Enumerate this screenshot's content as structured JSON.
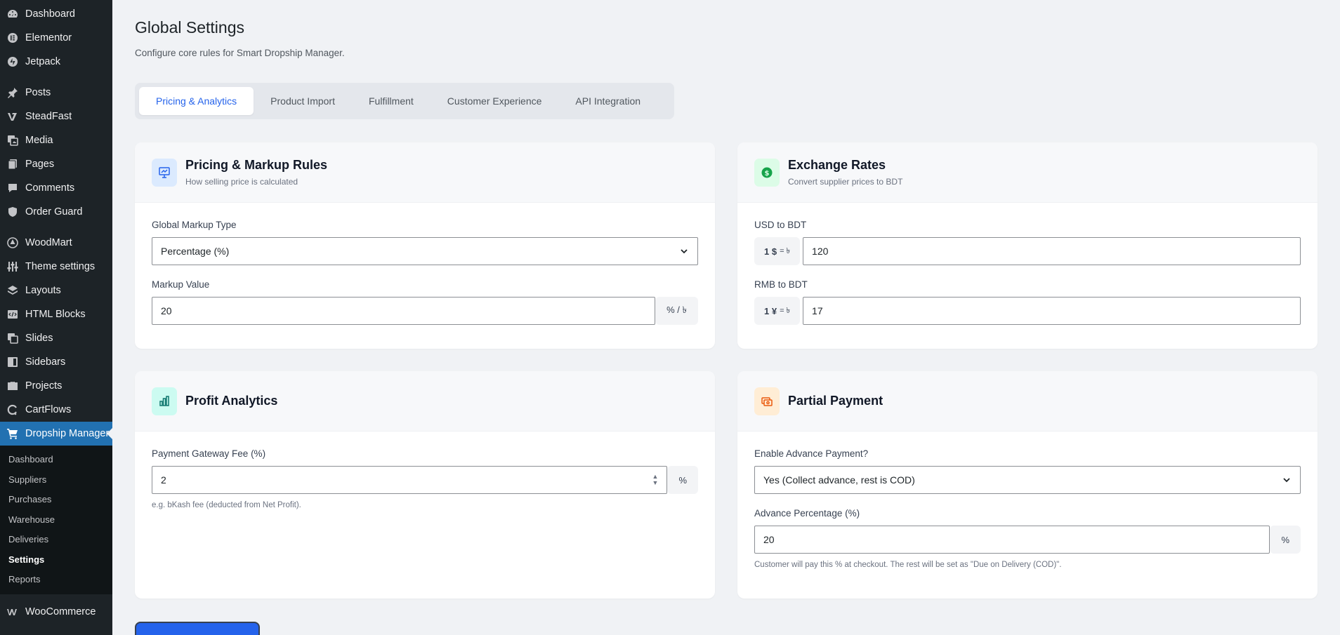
{
  "sidebar": {
    "items": [
      {
        "label": "Dashboard",
        "icon": "dashboard-icon"
      },
      {
        "label": "Elementor",
        "icon": "elementor-icon"
      },
      {
        "label": "Jetpack",
        "icon": "jetpack-icon"
      },
      {
        "label": "Posts",
        "icon": "pin-icon"
      },
      {
        "label": "SteadFast",
        "icon": "steadfast-icon"
      },
      {
        "label": "Media",
        "icon": "media-icon"
      },
      {
        "label": "Pages",
        "icon": "pages-icon"
      },
      {
        "label": "Comments",
        "icon": "comment-icon"
      },
      {
        "label": "Order Guard",
        "icon": "shield-icon"
      },
      {
        "label": "WoodMart",
        "icon": "woodmart-icon"
      },
      {
        "label": "Theme settings",
        "icon": "sliders-icon"
      },
      {
        "label": "Layouts",
        "icon": "layers-icon"
      },
      {
        "label": "HTML Blocks",
        "icon": "html-icon"
      },
      {
        "label": "Slides",
        "icon": "slides-icon"
      },
      {
        "label": "Sidebars",
        "icon": "sidebar-icon"
      },
      {
        "label": "Projects",
        "icon": "briefcase-icon"
      },
      {
        "label": "CartFlows",
        "icon": "cartflows-icon"
      },
      {
        "label": "Dropship Manager",
        "icon": "cart-icon"
      }
    ],
    "submenu": [
      "Dashboard",
      "Suppliers",
      "Purchases",
      "Warehouse",
      "Deliveries",
      "Settings",
      "Reports"
    ],
    "current_submenu": "Settings",
    "woocommerce": {
      "label": "WooCommerce",
      "icon": "woocommerce-icon"
    }
  },
  "header": {
    "title": "Global Settings",
    "subtitle": "Configure core rules for Smart Dropship Manager."
  },
  "tabs": [
    "Pricing & Analytics",
    "Product Import",
    "Fulfillment",
    "Customer Experience",
    "API Integration"
  ],
  "active_tab": "Pricing & Analytics",
  "pricing": {
    "title": "Pricing & Markup Rules",
    "desc": "How selling price is calculated",
    "markup_type_label": "Global Markup Type",
    "markup_type_value": "Percentage (%)",
    "markup_value_label": "Markup Value",
    "markup_value": "20",
    "markup_addon": "% / ৳"
  },
  "exchange": {
    "title": "Exchange Rates",
    "desc": "Convert supplier prices to BDT",
    "usd_label": "USD to BDT",
    "usd_prefix_bold": "1 $",
    "usd_prefix_rest": "= ৳",
    "usd_value": "120",
    "rmb_label": "RMB to BDT",
    "rmb_prefix_bold": "1 ¥",
    "rmb_prefix_rest": "= ৳",
    "rmb_value": "17"
  },
  "profit": {
    "title": "Profit Analytics",
    "fee_label": "Payment Gateway Fee (%)",
    "fee_value": "2",
    "fee_addon": "%",
    "fee_help": "e.g. bKash fee (deducted from Net Profit)."
  },
  "partial": {
    "title": "Partial Payment",
    "enable_label": "Enable Advance Payment?",
    "enable_value": "Yes (Collect advance, rest is COD)",
    "percent_label": "Advance Percentage (%)",
    "percent_value": "20",
    "percent_addon": "%",
    "percent_help": "Customer will pay this % at checkout. The rest will be set as \"Due on Delivery (COD)\"."
  },
  "colors": {
    "sidebar_bg": "#1d2327",
    "active_menu": "#2271b1",
    "accent": "#2563eb"
  }
}
